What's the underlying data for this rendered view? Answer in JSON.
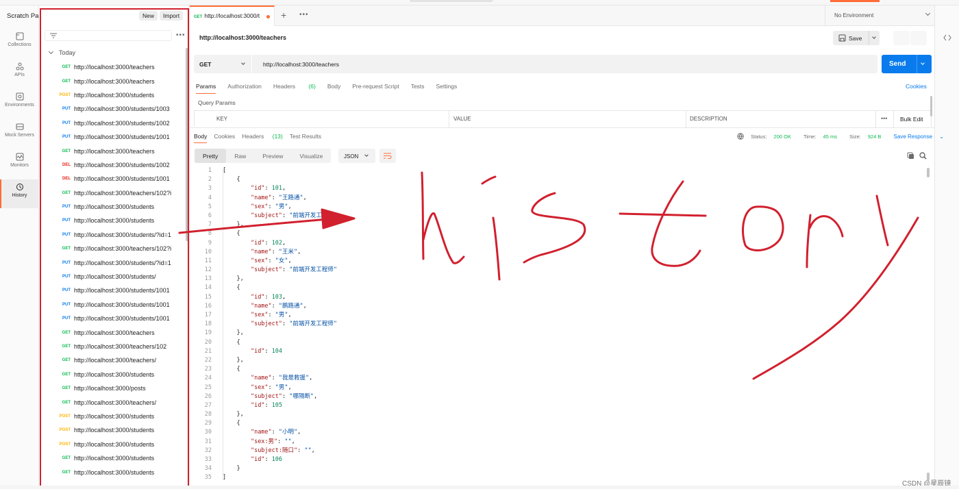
{
  "app": {
    "workspace_title": "Scratch Pad",
    "new_label": "New",
    "import_label": "Import"
  },
  "nav": {
    "items": [
      {
        "label": "Collections",
        "icon": "collections-icon"
      },
      {
        "label": "APIs",
        "icon": "apis-icon"
      },
      {
        "label": "Environments",
        "icon": "environments-icon"
      },
      {
        "label": "Mock Servers",
        "icon": "mock-servers-icon"
      },
      {
        "label": "Monitors",
        "icon": "monitors-icon"
      },
      {
        "label": "History",
        "icon": "history-icon",
        "active": true
      }
    ]
  },
  "history": {
    "group_label": "Today",
    "items": [
      {
        "method": "GET",
        "url": "http://localhost:3000/teachers"
      },
      {
        "method": "GET",
        "url": "http://localhost:3000/teachers"
      },
      {
        "method": "POST",
        "url": "http://localhost:3000/students"
      },
      {
        "method": "PUT",
        "url": "http://localhost:3000/students/1003"
      },
      {
        "method": "PUT",
        "url": "http://localhost:3000/students/1002"
      },
      {
        "method": "PUT",
        "url": "http://localhost:3000/students/1001"
      },
      {
        "method": "GET",
        "url": "http://localhost:3000/teachers"
      },
      {
        "method": "DEL",
        "url": "http://localhost:3000/students/1002"
      },
      {
        "method": "DEL",
        "url": "http://localhost:3000/students/1001"
      },
      {
        "method": "GET",
        "url": "http://localhost:3000/teachers/102?i"
      },
      {
        "method": "PUT",
        "url": "http://localhost:3000/students"
      },
      {
        "method": "PUT",
        "url": "http://localhost:3000/students"
      },
      {
        "method": "PUT",
        "url": "http://localhost:3000/students/?id=1"
      },
      {
        "method": "GET",
        "url": "http://localhost:3000/teachers/102?i"
      },
      {
        "method": "PUT",
        "url": "http://localhost:3000/students/?id=1"
      },
      {
        "method": "PUT",
        "url": "http://localhost:3000/students/"
      },
      {
        "method": "PUT",
        "url": "http://localhost:3000/students/1001"
      },
      {
        "method": "PUT",
        "url": "http://localhost:3000/students/1001"
      },
      {
        "method": "PUT",
        "url": "http://localhost:3000/students/1001"
      },
      {
        "method": "GET",
        "url": "http://localhost:3000/teachers"
      },
      {
        "method": "GET",
        "url": "http://localhost:3000/teachers/102"
      },
      {
        "method": "GET",
        "url": "http://localhost:3000/teachers/"
      },
      {
        "method": "GET",
        "url": "http://localhost:3000/students"
      },
      {
        "method": "GET",
        "url": "http://localhost:3000/posts"
      },
      {
        "method": "GET",
        "url": "http://localhost:3000/teachers/"
      },
      {
        "method": "POST",
        "url": "http://localhost:3000/students"
      },
      {
        "method": "POST",
        "url": "http://localhost:3000/students"
      },
      {
        "method": "POST",
        "url": "http://localhost:3000/students"
      },
      {
        "method": "GET",
        "url": "http://localhost:3000/students"
      },
      {
        "method": "GET",
        "url": "http://localhost:3000/students"
      }
    ]
  },
  "tab": {
    "method": "GET",
    "title": "http://localhost:3000/t"
  },
  "environment": {
    "selected": "No Environment"
  },
  "request": {
    "title": "http://localhost:3000/teachers",
    "save_label": "Save",
    "method": "GET",
    "url": "http://localhost:3000/teachers",
    "send_label": "Send",
    "tabs": [
      {
        "label": "Params",
        "active": true
      },
      {
        "label": "Authorization"
      },
      {
        "label": "Headers",
        "count": "(6)"
      },
      {
        "label": "Body"
      },
      {
        "label": "Pre-request Script"
      },
      {
        "label": "Tests"
      },
      {
        "label": "Settings"
      }
    ],
    "cookies_label": "Cookies",
    "query_params_label": "Query Params",
    "columns": [
      "KEY",
      "VALUE",
      "DESCRIPTION"
    ],
    "bulk_edit_label": "Bulk Edit"
  },
  "response": {
    "tabs": [
      {
        "label": "Body",
        "active": true
      },
      {
        "label": "Cookies"
      },
      {
        "label": "Headers",
        "count": "(13)"
      },
      {
        "label": "Test Results"
      }
    ],
    "status_label": "Status:",
    "status_value": "200 OK",
    "time_label": "Time:",
    "time_value": "45 ms",
    "size_label": "Size:",
    "size_value": "924 B",
    "save_response_label": "Save Response",
    "formats": [
      {
        "label": "Pretty",
        "active": true
      },
      {
        "label": "Raw"
      },
      {
        "label": "Preview"
      },
      {
        "label": "Visualize"
      }
    ],
    "language": "JSON",
    "lines": [
      "[",
      "    {",
      "        \"id\": 101,",
      "        \"name\": \"王路通\",",
      "        \"sex\": \"男\",",
      "        \"subject\": \"前端开发工程师\"",
      "    },",
      "    {",
      "        \"id\": 102,",
      "        \"name\": \"王米\",",
      "        \"sex\": \"女\",",
      "        \"subject\": \"前端开发工程师\"",
      "    },",
      "    {",
      "        \"id\": 103,",
      "        \"name\": \"鹏路通\",",
      "        \"sex\": \"男\",",
      "        \"subject\": \"前端开发工程师\"",
      "    },",
      "    {",
      "        \"id\": 104",
      "    },",
      "    {",
      "        \"name\": \"我是救援\",",
      "        \"sex\": \"男\",",
      "        \"subject\": \"哪隔断\",",
      "        \"id\": 105",
      "    },",
      "    {",
      "        \"name\": \"小明\",",
      "        \"sex:男\": \"\",",
      "        \"subject:随口\": \"\",",
      "        \"id\": 106",
      "    }",
      "]"
    ]
  },
  "annotation": {
    "color": "#d1202e"
  },
  "watermark": "CSDN @星辰镜"
}
